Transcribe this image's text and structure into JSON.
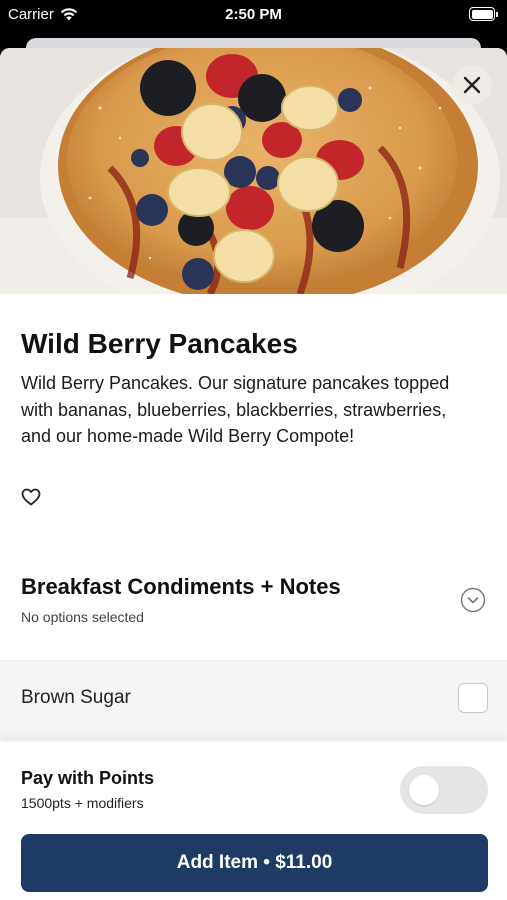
{
  "status_bar": {
    "carrier": "Carrier",
    "time": "2:50 PM",
    "wifi_icon": "wifi-icon",
    "battery_icon": "battery-full-icon"
  },
  "item": {
    "title": "Wild Berry Pancakes",
    "description": "Wild Berry Pancakes. Our signature pancakes topped with bananas, blueberries, blackberries, strawberries, and our home-made Wild Berry Compote!",
    "favorite_icon": "heart-outline-icon",
    "close_icon": "close-icon"
  },
  "modifier_section": {
    "title": "Breakfast Condiments + Notes",
    "subtitle": "No options selected",
    "expand_icon": "chevron-down-circle-icon",
    "options": [
      {
        "label": "Brown Sugar",
        "checked": false
      }
    ]
  },
  "points": {
    "title": "Pay with Points",
    "subtitle": "1500pts + modifiers",
    "enabled": false
  },
  "add_button": {
    "label": "Add Item • $11.00"
  },
  "colors": {
    "primary_button": "#1f3a64",
    "toggle_off": "#e6e6e6",
    "option_row_bg": "#f5f5f5"
  }
}
